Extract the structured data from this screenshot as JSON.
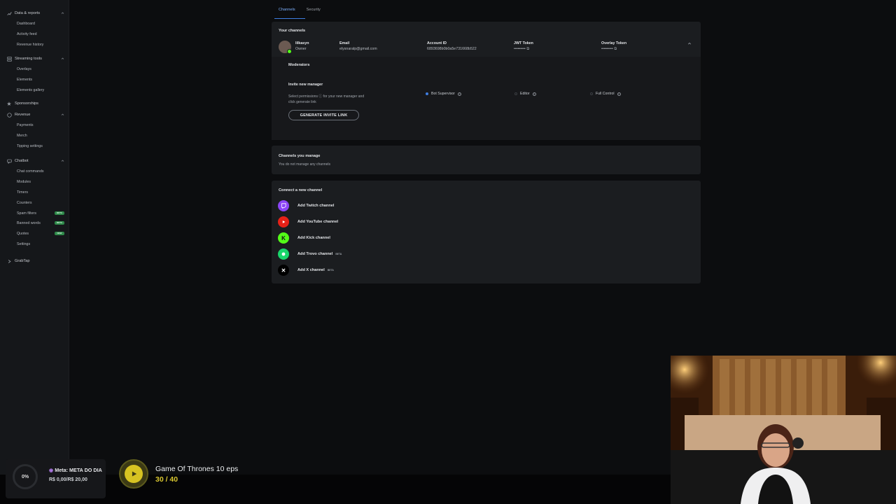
{
  "sidebar": {
    "groups": [
      {
        "label": "Data & reports",
        "icon": "chart-icon",
        "items": [
          "Dashboard",
          "Activity feed",
          "Revenue history"
        ]
      },
      {
        "label": "Streaming tools",
        "icon": "layers-icon",
        "items": [
          "Overlays",
          "Elements",
          "Elements gallery"
        ]
      },
      {
        "label": "Sponsorships",
        "icon": "star-icon",
        "items": []
      },
      {
        "label": "Revenue",
        "icon": "coin-icon",
        "items": [
          "Payments",
          "Merch",
          "Tipping settings"
        ]
      },
      {
        "label": "Chatbot",
        "icon": "chat-icon",
        "items": [
          "Chat commands",
          "Modules",
          "Timers",
          "Counters",
          "Spam filters",
          "Banned words",
          "Quotes",
          "Settings"
        ]
      },
      {
        "label": "GrabTap",
        "icon": "grab-icon",
        "items": []
      }
    ],
    "badges": {
      "spam_filters": "BETA",
      "banned_words": "BETA",
      "quotes": "NEW"
    }
  },
  "tabs": [
    "Channels",
    "Security"
  ],
  "your_channels": {
    "title": "Your channels",
    "user": {
      "name": "lilkasyn",
      "role": "Owner"
    },
    "email": {
      "label": "Email",
      "value": "elysnaralp@gmail.com"
    },
    "account_id": {
      "label": "Account ID",
      "value": "6893698b0b0a5e731668b522"
    },
    "jwt": {
      "label": "JWT Token",
      "value": "•••••••••"
    },
    "overlay": {
      "label": "Overlay Token",
      "value": "•••••••••"
    },
    "moderators": "Moderators",
    "invite_title": "Invite new manager",
    "invite_desc": "Select permissions ⓘ for your new manager and click generate link",
    "permissions": [
      "Bot Supervisor",
      "Editor",
      "Full Control"
    ],
    "selected_permission": "Bot Supervisor",
    "generate_button": "GENERATE INVITE LINK"
  },
  "channels_manage": {
    "title": "Channels you manage",
    "empty": "You do not manage any channels"
  },
  "connect": {
    "title": "Connect a new channel",
    "items": [
      {
        "label": "Add Twitch channel",
        "color": "#8c45f7",
        "icon": "twitch-icon",
        "beta": ""
      },
      {
        "label": "Add YouTube channel",
        "color": "#e62117",
        "icon": "youtube-icon",
        "beta": ""
      },
      {
        "label": "Add Kick channel",
        "color": "#53fc18",
        "icon": "kick-icon",
        "beta": ""
      },
      {
        "label": "Add Trovo channel",
        "color": "#19d66b",
        "icon": "trovo-icon",
        "beta": "BETA"
      },
      {
        "label": "Add X channel",
        "color": "#000000",
        "icon": "x-icon",
        "beta": "BETA"
      }
    ]
  },
  "goal_widget": {
    "percent": "0%",
    "meta": "Meta: META DO DIA",
    "amount": "R$ 0,00/R$ 20,00"
  },
  "progress_widget": {
    "title": "Game Of Thrones 10 eps",
    "count": "30 / 40"
  },
  "colors": {
    "accent": "#3f7de0",
    "background": "#0c0d0f",
    "card": "#1b1d20",
    "goal_yellow": "#d7c322"
  }
}
